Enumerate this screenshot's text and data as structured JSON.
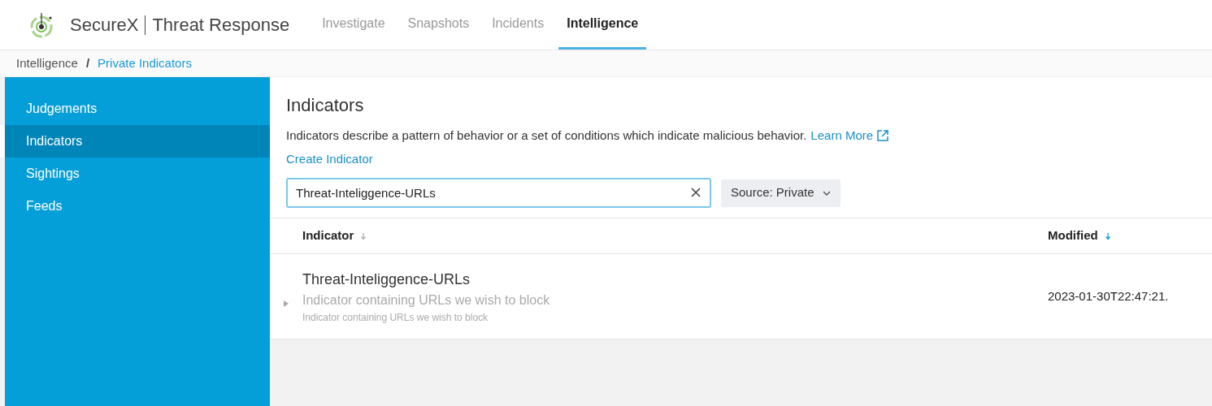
{
  "header": {
    "brand": "SecureX",
    "product": "Threat Response",
    "nav": [
      {
        "label": "Investigate",
        "selected": false
      },
      {
        "label": "Snapshots",
        "selected": false
      },
      {
        "label": "Incidents",
        "selected": false
      },
      {
        "label": "Intelligence",
        "selected": true
      }
    ]
  },
  "breadcrumb_separator": "/",
  "breadcrumb": [
    {
      "label": "Intelligence",
      "current": false
    },
    {
      "label": "Private Indicators",
      "current": true
    }
  ],
  "sidebar": {
    "items": [
      {
        "label": "Judgements",
        "selected": false
      },
      {
        "label": "Indicators",
        "selected": true
      },
      {
        "label": "Sightings",
        "selected": false
      },
      {
        "label": "Feeds",
        "selected": false
      }
    ]
  },
  "page": {
    "title": "Indicators",
    "description": "Indicators describe a pattern of behavior or a set of conditions which indicate malicious behavior.",
    "learn_more": "Learn More",
    "create": "Create Indicator",
    "search": {
      "value": "Threat-Inteliggence-URLs"
    },
    "source_filter": "Source: Private"
  },
  "table": {
    "columns": [
      {
        "label": "Indicator",
        "sorted": false
      },
      {
        "label": "Modified",
        "sorted": true
      }
    ],
    "rows": [
      {
        "title": "Threat-Inteliggence-URLs",
        "description": "Indicator containing URLs we wish to block",
        "subtext": "Indicator containing URLs we wish to block",
        "modified": "2023-01-30T22:47:21.",
        "expanded": false
      }
    ]
  }
}
